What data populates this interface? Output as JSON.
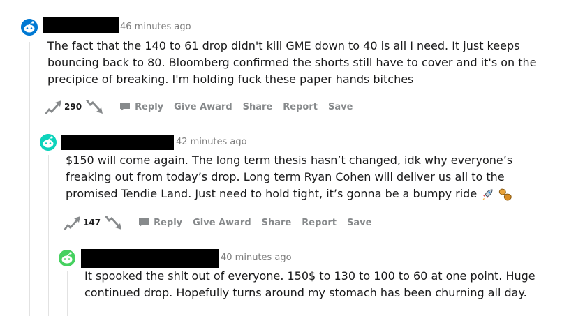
{
  "comments": [
    {
      "timestamp": "46 minutes ago",
      "body": [
        "The fact that the 140 to 61 drop didn't kill GME down to 40 is all I need. It just keeps",
        "bouncing back to 80. Bloomberg confirmed the shorts still have to cover and it's on the",
        "precipice of breaking. I'm holding fuck these paper hands bitches"
      ],
      "score": "290",
      "actions": {
        "reply": "Reply",
        "award": "Give Award",
        "share": "Share",
        "report": "Report",
        "save": "Save"
      },
      "avatar_color": "#0079d3"
    },
    {
      "timestamp": "42 minutes ago",
      "body": [
        "$150 will come again. The long term thesis hasn’t changed, idk why everyone’s",
        "freaking out from today’s drop. Long term Ryan Cohen will deliver us all to the",
        "promised Tendie Land. Just need to hold tight, it’s gonna be a bumpy ride"
      ],
      "emojis": [
        "rocket-icon",
        "tendies-icon"
      ],
      "score": "147",
      "actions": {
        "reply": "Reply",
        "award": "Give Award",
        "share": "Share",
        "report": "Report",
        "save": "Save"
      },
      "avatar_color": "#0dd3bb"
    },
    {
      "timestamp": "40 minutes ago",
      "body": [
        "It spooked the shit out of everyone. 150$ to 130 to 100 to 60 at one point. Huge",
        "continued drop. Hopefully turns around my stomach has been churning all day."
      ],
      "avatar_color": "#46d160"
    }
  ],
  "colors": {
    "text": "#1a1a1b",
    "meta": "#7c7c7c",
    "action": "#878a8c",
    "thread_line": "#e2e2e2",
    "redaction": "#000000"
  }
}
